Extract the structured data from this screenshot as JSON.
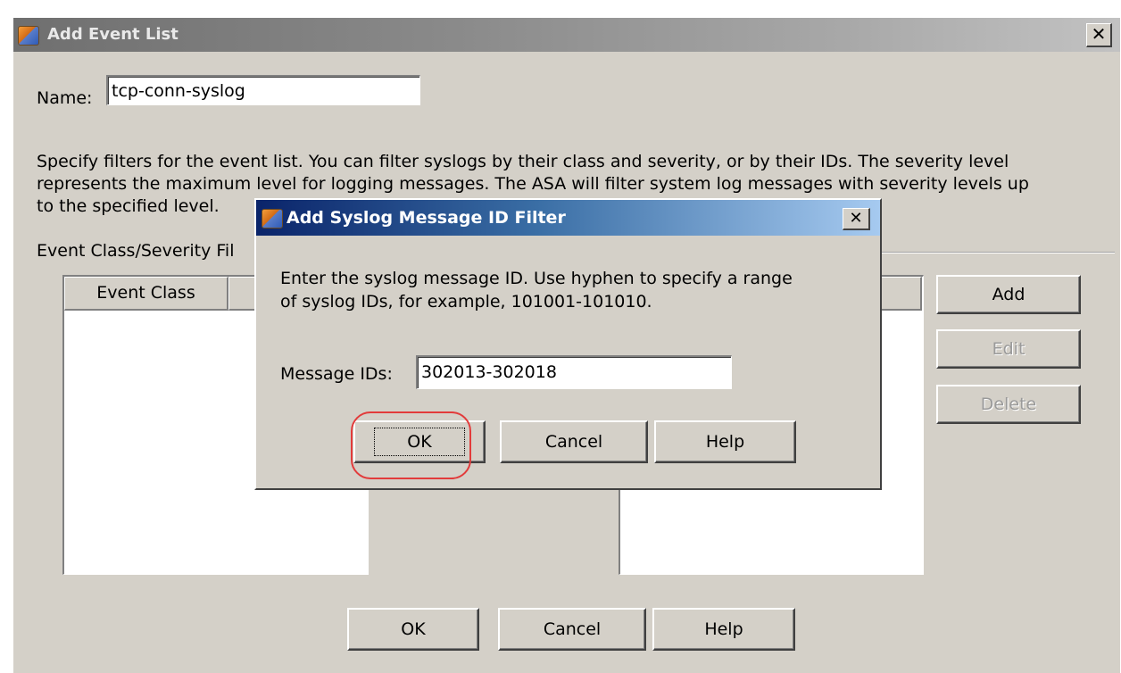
{
  "main_dialog": {
    "title": "Add Event List",
    "close_glyph": "✕",
    "name_label": "Name:",
    "name_value": "tcp-conn-syslog",
    "description_lines": [
      "Specify filters for the event list. You can filter syslogs by their class and severity, or by their IDs. The severity level",
      "represents the maximum level for logging messages. The ASA will filter system log messages with severity levels up",
      "to the specified level."
    ],
    "group_label": "Event Class/Severity Fil",
    "table_column": "Event Class",
    "side_buttons": {
      "add": "Add",
      "edit": "Edit",
      "delete": "Delete"
    },
    "bottom_buttons": {
      "ok": "OK",
      "cancel": "Cancel",
      "help": "Help"
    }
  },
  "sub_dialog": {
    "title": "Add Syslog Message ID Filter",
    "close_glyph": "✕",
    "instruction_lines": [
      "Enter the syslog message ID. Use hyphen to specify a range",
      "of syslog IDs, for example, 101001-101010."
    ],
    "message_ids_label": "Message IDs:",
    "message_ids_value": "302013-302018",
    "buttons": {
      "ok": "OK",
      "cancel": "Cancel",
      "help": "Help"
    }
  },
  "colors": {
    "dialog_face": "#d4d0c8",
    "inactive_title": "#8a8a8a",
    "active_title_start": "#0a246a",
    "active_title_end": "#a6caf0",
    "highlight_oval": "#e23b3b"
  },
  "icons": [
    "app-icon",
    "close-icon"
  ]
}
